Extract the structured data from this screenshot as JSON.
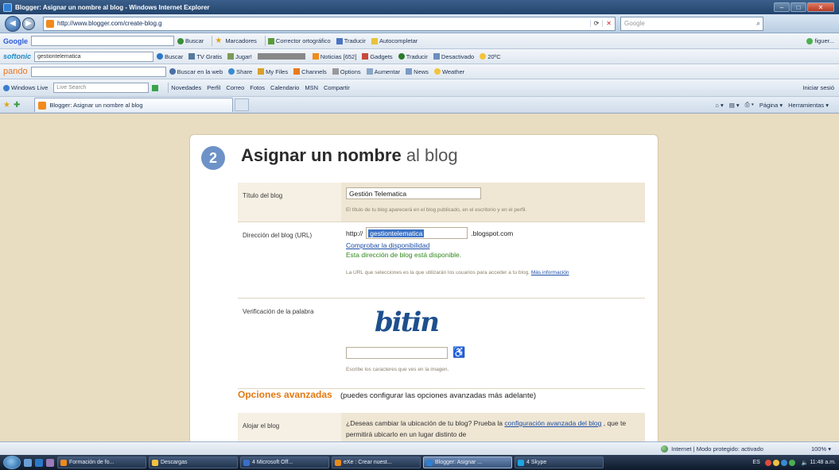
{
  "window": {
    "title": "Blogger: Asignar un nombre al blog - Windows Internet Explorer"
  },
  "address_bar": {
    "url": "http://www.blogger.com/create-blog.g",
    "search_placeholder": "Google"
  },
  "google_toolbar": {
    "logo": "Google",
    "items": [
      "Buscar",
      "Marcadores",
      "Corrector ortográfico",
      "Traducir",
      "Autocompletar"
    ],
    "right_user": "figuer..."
  },
  "softonic_toolbar": {
    "logo": "softonic",
    "search_value": "gestiontelematica",
    "items": [
      "Buscar",
      "TV Gratis",
      "Jugar!",
      "Noticias [652]",
      "Gadgets",
      "Traducir",
      "Desactivado",
      "20ºC"
    ]
  },
  "pando_toolbar": {
    "logo": "pando",
    "items": [
      "Buscar en la web",
      "Share",
      "My Files",
      "Channels",
      "Options",
      "Aumentar",
      "News",
      "Weather"
    ]
  },
  "live_toolbar": {
    "logo": "Windows Live",
    "search_placeholder": "Live Search",
    "links": [
      "Novedades",
      "Perfil",
      "Correo",
      "Fotos",
      "Calendario",
      "MSN",
      "Compartir"
    ],
    "right_link": "Iniciar sesió"
  },
  "tabs_bar": {
    "active_tab": "Blogger: Asignar un nombre al blog",
    "right_items": [
      "Página",
      "Herramientas"
    ]
  },
  "page": {
    "step_number": "2",
    "heading_bold": "Asignar un nombre",
    "heading_light": "al blog",
    "title_row": {
      "label": "Título del blog",
      "value": "Gestión Telematica",
      "help": "El título de tu blog aparecerá en el blog publicado, en el escritorio y en el perfil."
    },
    "url_row": {
      "label": "Dirección del blog (URL)",
      "prefix": "http://",
      "value": "gestiontelematica",
      "suffix": ".blogspot.com",
      "check_link": "Comprobar la disponibilidad",
      "available_msg": "Esta dirección de blog está disponible.",
      "help": "La URL que selecciones es la que utilizarán los usuarios para acceder a tu blog.",
      "more_link": "Más información"
    },
    "captcha_row": {
      "label": "Verificación de la palabra",
      "captcha_text": "bitin",
      "help": "Escribe los caracteres que ves en la imagen."
    },
    "advanced": {
      "title": "Opciones avanzadas",
      "subtitle": "(puedes configurar las opciones avanzadas más adelante)"
    },
    "host_row": {
      "label": "Alojar el blog",
      "text_before": "¿Deseas cambiar la ubicación de tu blog? Prueba la",
      "link": "configuración avanzada del blog",
      "text_after": ", que te permitirá ubicarlo en un lugar distinto de"
    }
  },
  "status_bar": {
    "zone": "Internet | Modo protegido: activado",
    "zoom": "100%"
  },
  "taskbar": {
    "tasks": [
      "Formación de fo...",
      "Descargas",
      "4 Microsoft Off...",
      "eXe : Crear nuest...",
      "Blogger: Asignar ...",
      "4 Skype"
    ],
    "active_index": 4,
    "lang": "ES",
    "clock": "11:48 a.m."
  }
}
